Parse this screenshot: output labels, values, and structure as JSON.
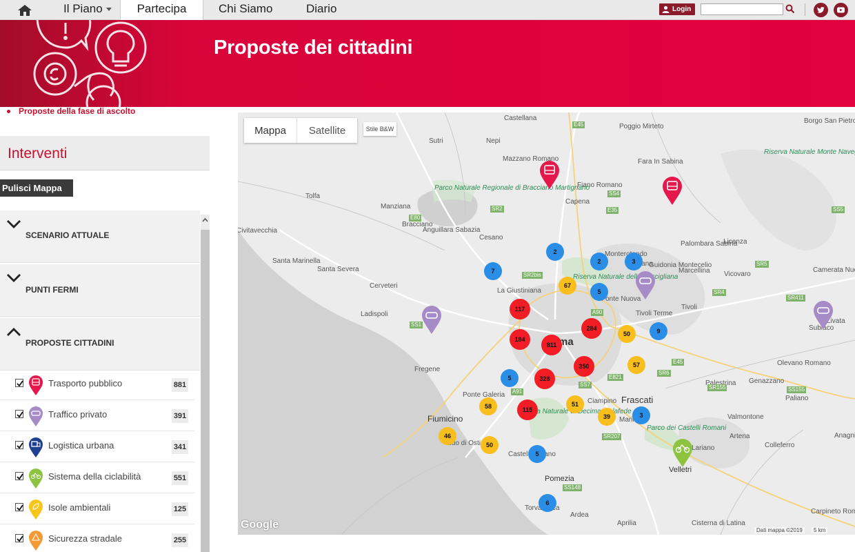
{
  "nav": {
    "tabs": [
      "Il Piano",
      "Partecipa",
      "Chi Siamo",
      "Diario"
    ],
    "active": "Partecipa",
    "login": "Login",
    "search_value": ""
  },
  "banner": {
    "title": "Proposte dei cittadini"
  },
  "sublink": "Proposte della fase di ascolto",
  "panel": {
    "title": "Interventi",
    "clear_button": "Pulisci Mappa",
    "sections": [
      "SCENARIO ATTUALE",
      "PUNTI FERMI",
      "PROPOSTE CITTADINI"
    ],
    "categories": [
      {
        "label": "Trasporto pubblico",
        "count": "881",
        "color": "#e5184b",
        "checked": true
      },
      {
        "label": "Traffico privato",
        "count": "391",
        "color": "#a78bc6",
        "checked": true
      },
      {
        "label": "Logistica urbana",
        "count": "341",
        "color": "#1f3f8f",
        "checked": true
      },
      {
        "label": "Sistema della ciclabilità",
        "count": "551",
        "color": "#8dc43f",
        "checked": true
      },
      {
        "label": "Isole ambientali",
        "count": "125",
        "color": "#f7c51b",
        "checked": true
      },
      {
        "label": "Sicurezza stradale",
        "count": "255",
        "color": "#f39a34",
        "checked": true
      }
    ]
  },
  "map": {
    "types": [
      "Mappa",
      "Satellite"
    ],
    "style_button": "Stile B&W",
    "attribution": "Dati mappa ©2019",
    "scale": "5 km",
    "logo": "Google",
    "city": "Roma",
    "places": [
      "Castellana",
      "Poggio Mirteto",
      "Borgo San Pietro",
      "Nepi",
      "Sutri",
      "Mazzano Romano",
      "Fara In Sabina",
      "Fiano Romano",
      "Capena",
      "Tolfa",
      "Manziana",
      "Bracciano",
      "Anguillara Sabazia",
      "Cesano",
      "Monterotondo",
      "Mentana",
      "Guidonia Montecelio",
      "Palombara Sabina",
      "Licenza",
      "Santa Marinella",
      "Santa Severa",
      "Cerveteri",
      "La Giustiniana",
      "Marcellina",
      "Vicovaro",
      "Camerata Nuova",
      "Ladispoli",
      "Tivoli",
      "Tivoli Terme",
      "Livata",
      "Subiaco",
      "Fregene",
      "Olevano Romano",
      "Genazzano",
      "Frascati",
      "Palestrina",
      "Ponte Galeria",
      "Fiumicino",
      "Lido di Ostia",
      "Ciampino",
      "Marino",
      "Valmontone",
      "Paliano",
      "Artena",
      "Colleferro",
      "Anagni",
      "Castel Romano",
      "Lariano",
      "Velletri",
      "Pomezia",
      "Torvaianica",
      "Ardea",
      "Aprilia",
      "Cisterna di Latina",
      "Carpineto Romano",
      "Civitavecchia",
      "Fonte Nuova"
    ],
    "parks": [
      "Parco Naturale Regionale di Bracciano Martignano",
      "Riserva Naturale della Marcigliana",
      "Riserva Naturale di Decima Malafede",
      "Riserva Naturale Monte Navegna E...",
      "Parco dei Castelli Romani"
    ],
    "roads": [
      "E45",
      "SS4",
      "E35",
      "SR2",
      "E80",
      "SR2bis",
      "SS1",
      "A90",
      "E821",
      "SS7",
      "A91",
      "E45",
      "SR6",
      "SR155",
      "SS155",
      "SR207",
      "SS148",
      "SR411",
      "SR5",
      "SS5",
      "SR4"
    ],
    "clusters": [
      {
        "value": "2",
        "color": "blue"
      },
      {
        "value": "2",
        "color": "blue"
      },
      {
        "value": "3",
        "color": "blue"
      },
      {
        "value": "7",
        "color": "blue"
      },
      {
        "value": "67",
        "color": "yellow"
      },
      {
        "value": "5",
        "color": "blue"
      },
      {
        "value": "117",
        "color": "red"
      },
      {
        "value": "284",
        "color": "red"
      },
      {
        "value": "50",
        "color": "yellow"
      },
      {
        "value": "9",
        "color": "blue"
      },
      {
        "value": "184",
        "color": "red"
      },
      {
        "value": "811",
        "color": "red"
      },
      {
        "value": "350",
        "color": "red"
      },
      {
        "value": "57",
        "color": "yellow"
      },
      {
        "value": "5",
        "color": "blue"
      },
      {
        "value": "328",
        "color": "red"
      },
      {
        "value": "58",
        "color": "yellow"
      },
      {
        "value": "51",
        "color": "yellow"
      },
      {
        "value": "115",
        "color": "red"
      },
      {
        "value": "39",
        "color": "yellow"
      },
      {
        "value": "3",
        "color": "blue"
      },
      {
        "value": "46",
        "color": "yellow"
      },
      {
        "value": "50",
        "color": "yellow"
      },
      {
        "value": "5",
        "color": "blue"
      },
      {
        "value": "6",
        "color": "blue"
      }
    ],
    "markers": [
      "bus-pin",
      "bus-pin",
      "car-pin",
      "car-pin",
      "car-pin",
      "bike-pin"
    ]
  }
}
